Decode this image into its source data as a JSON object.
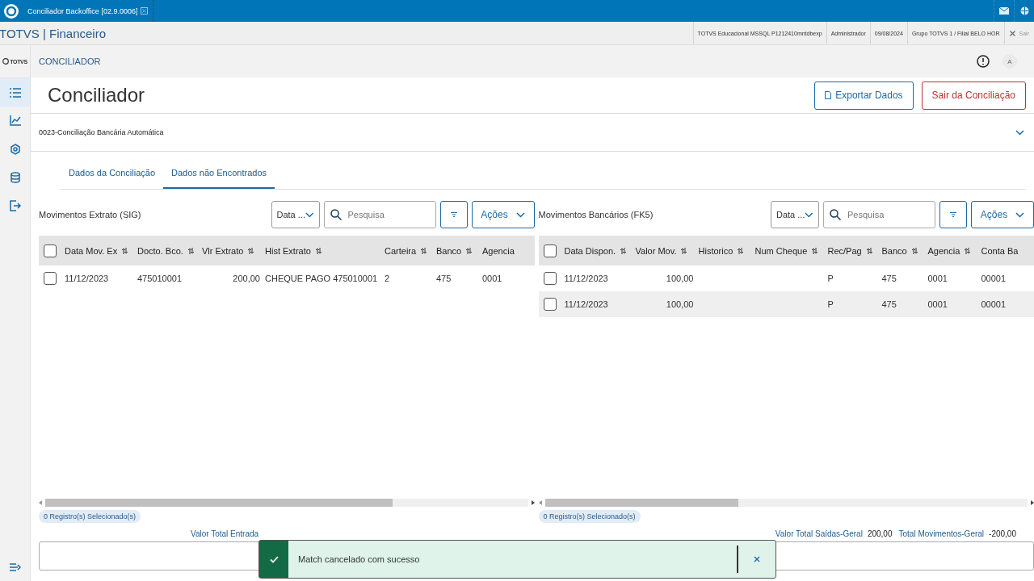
{
  "window": {
    "tab_title": "Conciliador Backoffice [02.9.0006]"
  },
  "header": {
    "title": "TOTVS | Financeiro",
    "info": [
      "TOTVS Educacional MSSQL P1212410mntdbexp",
      "Administrador",
      "09/08/2024",
      "Grupo TOTVS 1 / Filial BELO HOR"
    ],
    "exit": "Sair"
  },
  "breadcrumb": "CONCILIADOR",
  "avatar": "A",
  "sidebar_logo": "TOTVS",
  "page": {
    "title": "Conciliador",
    "buttons": [
      {
        "label": "Exportar Dados",
        "kind": "primary"
      },
      {
        "label": "Sair da Conciliação",
        "kind": "danger"
      }
    ]
  },
  "accordion": {
    "title": "0023-Conciliação Bancária Automática",
    "expanded": false
  },
  "tabs": [
    {
      "label": "Dados da Conciliação",
      "selected": false
    },
    {
      "label": "Dados não Encontrados",
      "selected": true
    }
  ],
  "panels": [
    {
      "title": "Movimentos Extrato (SIG)",
      "all_checked": false,
      "order_select": "Data ...",
      "search_placeholder": "Pesquisa",
      "actions": "Ações",
      "columns": [
        "Data Mov. Ex",
        "Docto. Bco.",
        "Vlr Extrato",
        "Hist Extrato",
        "Carteira",
        "Banco",
        "Agencia"
      ],
      "rows": [
        {
          "checked": false,
          "cells": [
            "11/12/2023",
            "475010001",
            "200,00",
            "CHEQUE PAGO 475010001",
            "2",
            "475",
            "0001"
          ]
        }
      ],
      "selected_count": "0 Registro(s) Selecionado(s)"
    },
    {
      "title": "Movimentos Bancários (FK5)",
      "all_checked": false,
      "order_select": "Data ...",
      "search_placeholder": "Pesquisa",
      "actions": "Ações",
      "columns": [
        "Data Dispon.",
        "Valor Mov.",
        "Historico",
        "Num Cheque",
        "Rec/Pag",
        "Banco",
        "Agencia",
        "Conta Ba"
      ],
      "rows": [
        {
          "checked": false,
          "cells": [
            "11/12/2023",
            "100,00",
            "",
            "",
            "P",
            "475",
            "0001",
            "00001"
          ]
        },
        {
          "checked": false,
          "cells": [
            "11/12/2023",
            "100,00",
            "",
            "",
            "P",
            "475",
            "0001",
            "00001"
          ]
        }
      ],
      "selected_count": "0 Registro(s) Selecionado(s)"
    }
  ],
  "totals": {
    "left_label": "Valor Total Entrada",
    "items": [
      {
        "label": "Valor Total Saídas-Geral",
        "value": "200,00"
      },
      {
        "label": "Total Movimentos-Geral",
        "value": "-200,00"
      }
    ]
  },
  "toast": {
    "kind": "success",
    "message": "Match cancelado com sucesso"
  }
}
